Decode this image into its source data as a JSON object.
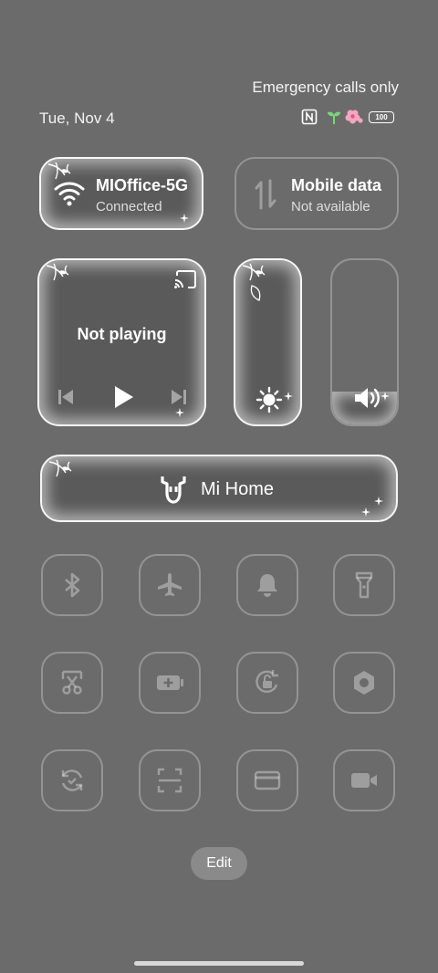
{
  "status": {
    "carrier": "Emergency calls only",
    "date": "Tue, Nov 4",
    "battery": "100"
  },
  "wifi": {
    "name": "MIOffice-5G",
    "status": "Connected",
    "icon": "wifi-icon"
  },
  "mobile_data": {
    "title": "Mobile data",
    "status": "Not available",
    "icon": "data-arrows-icon"
  },
  "media": {
    "status": "Not playing"
  },
  "sliders": {
    "brightness_level": 0.2,
    "volume_level": 0.2
  },
  "mi_home": {
    "label": "Mi Home"
  },
  "toggles": [
    {
      "name": "bluetooth",
      "icon": "bluetooth-icon"
    },
    {
      "name": "airplane",
      "icon": "airplane-icon"
    },
    {
      "name": "notifications",
      "icon": "bell-icon"
    },
    {
      "name": "flashlight",
      "icon": "flashlight-icon"
    },
    {
      "name": "screenshot",
      "icon": "scissors-icon"
    },
    {
      "name": "battery-saver",
      "icon": "battery-icon"
    },
    {
      "name": "rotation-lock",
      "icon": "rotation-lock-icon"
    },
    {
      "name": "settings",
      "icon": "hex-nut-icon"
    },
    {
      "name": "sync",
      "icon": "sync-icon"
    },
    {
      "name": "scanner",
      "icon": "scan-icon"
    },
    {
      "name": "cards",
      "icon": "card-icon"
    },
    {
      "name": "screen-recorder",
      "icon": "video-icon"
    }
  ],
  "edit_label": "Edit"
}
